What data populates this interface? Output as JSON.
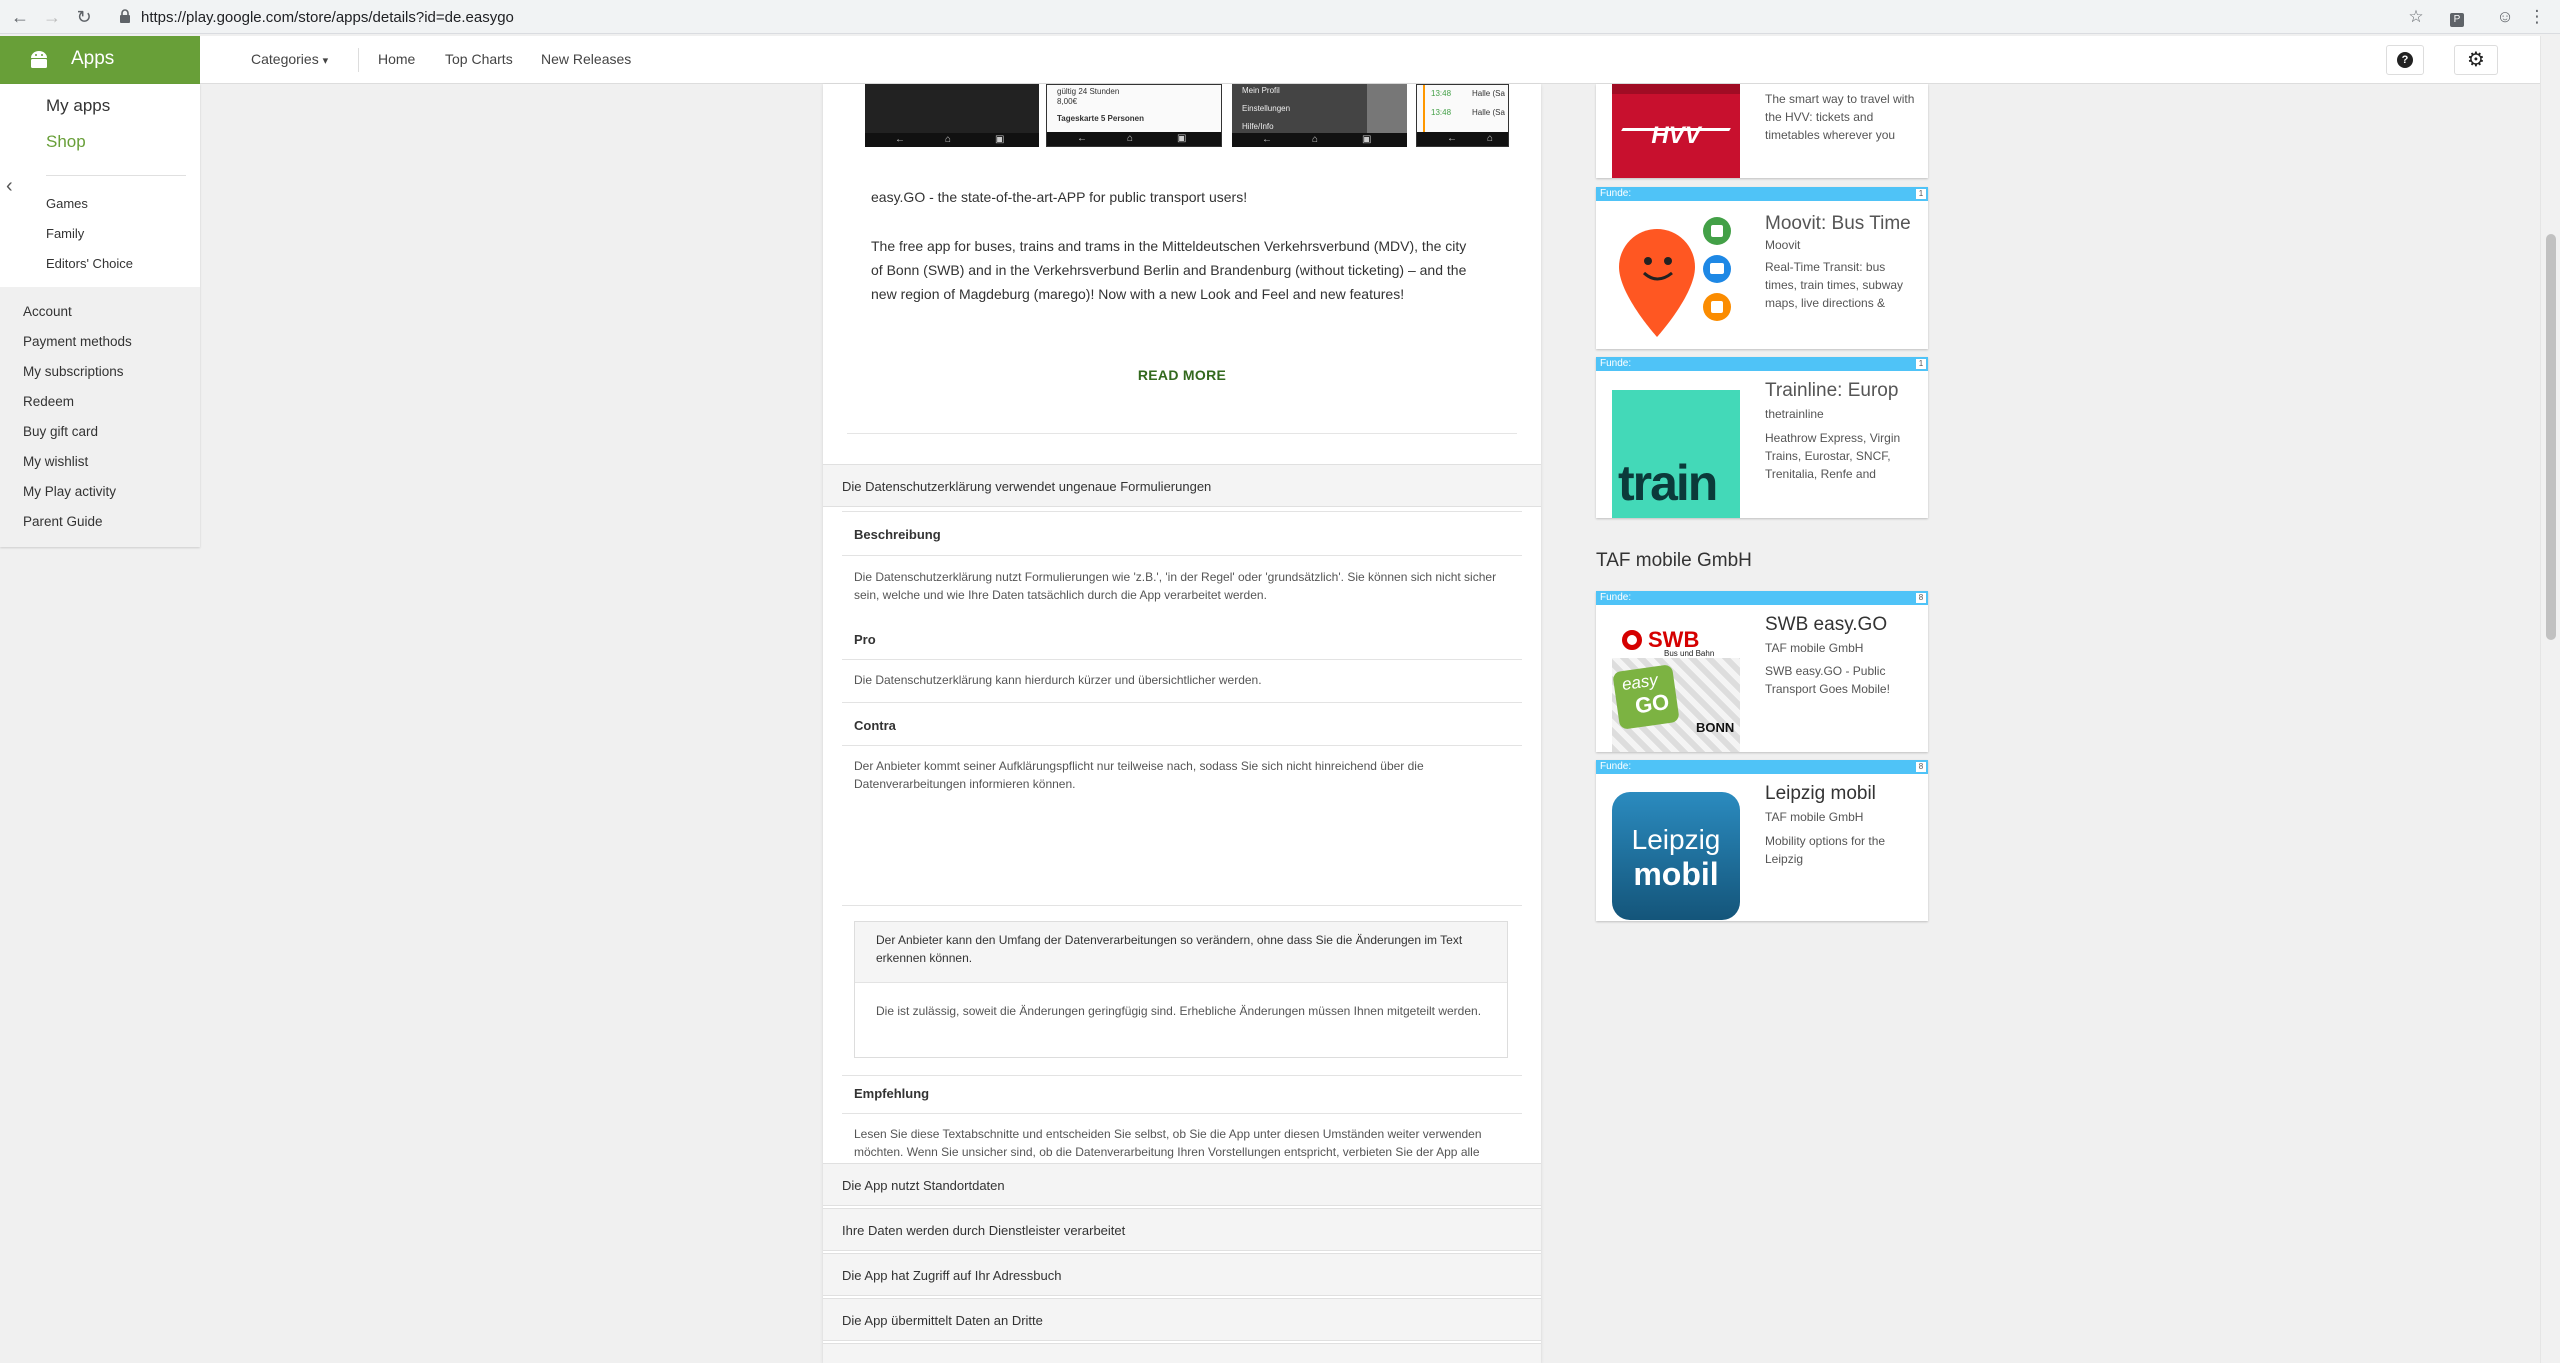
{
  "browser": {
    "url": "https://play.google.com/store/apps/details?id=de.easygo",
    "profile_letter": "P"
  },
  "header": {
    "apps_label": "Apps",
    "categories_label": "Categories",
    "home_label": "Home",
    "top_charts_label": "Top Charts",
    "new_releases_label": "New Releases",
    "help_glyph": "?"
  },
  "sidebar": {
    "my_apps": "My apps",
    "shop": "Shop",
    "items": [
      "Games",
      "Family",
      "Editors' Choice"
    ],
    "account_links": [
      "Account",
      "Payment methods",
      "My subscriptions",
      "Redeem",
      "Buy gift card",
      "My wishlist",
      "My Play activity",
      "Parent Guide"
    ]
  },
  "screenshots": {
    "shot2_line1": "gültig 24 Stunden",
    "shot2_line2": "8,00€",
    "shot2_line3": "Tageskarte 5 Personen",
    "shot3_line1": "Mein Profil",
    "shot3_line2": "Einstellungen",
    "shot3_line3": "Hilfe/Info",
    "shot4_line1": "13:48",
    "shot4_line2": "13:48",
    "shot4_label1": "Halle (Sa",
    "shot4_label2": "Halle (Sa"
  },
  "description": {
    "short": "easy.GO - the state-of-the-art-APP for public transport users!",
    "long": "The free app for buses, trains and trams in the Mitteldeutschen Verkehrsverbund (MDV), the city of Bonn (SWB) and in the Verkehrsverbund Berlin and Brandenburg (without ticketing) – and the new region of Magdeburg (marego)! Now with a new Look and Feel and new features!",
    "read_more": "READ MORE"
  },
  "privacy": {
    "open_title": "Die Datenschutzerklärung verwendet ungenaue Formulierungen",
    "beschreibung_title": "Beschreibung",
    "beschreibung_text": "Die Datenschutzerklärung nutzt Formulierungen wie 'z.B.', 'in der Regel' oder 'grundsätzlich'. Sie können sich nicht sicher sein, welche und wie Ihre Daten tatsächlich durch die App verarbeitet werden.",
    "pro_title": "Pro",
    "pro_text": "Die Datenschutzerklärung kann hierdurch kürzer und übersichtlicher werden.",
    "contra_title": "Contra",
    "contra_text": "Der Anbieter kommt seiner Aufklärungspflicht nur teilweise nach, sodass Sie sich nicht hinreichend über die Datenverarbeitungen informieren können.",
    "nested_title": "Der Anbieter kann den Umfang der Datenverarbeitungen so verändern, ohne dass Sie die Änderungen im Text erkennen können.",
    "nested_text": "Die ist zulässig, soweit die Änderungen geringfügig sind. Erhebliche Änderungen müssen Ihnen mitgeteilt werden.",
    "empfehlung_title": "Empfehlung",
    "empfehlung_text": "Lesen Sie diese Textabschnitte und entscheiden Sie selbst, ob Sie die App unter diesen Umständen weiter verwenden möchten. Wenn Sie unsicher sind, ob die Datenverarbeitung Ihren Vorstellungen entspricht, verbieten Sie der App alle Zugriffe auf Daten, die aus Ihrer Sicht besonders schützenswert sind (z.B. Fotos, Adressbuch, Standort oder Kalender).",
    "collapsed": [
      "Die App nutzt Standortdaten",
      "Ihre Daten werden durch Dienstleister verarbeitet",
      "Die App hat Zugriff auf Ihr Adressbuch",
      "Die App übermittelt Daten an Dritte"
    ]
  },
  "similar": {
    "hvv": {
      "desc": "The smart way to travel with the HVV: tickets and timetables wherever you",
      "logo_text": "HVV"
    },
    "moovit": {
      "funde": "Funde:",
      "count": "1",
      "title": "Moovit: Bus Time",
      "developer": "Moovit",
      "desc": "Real-Time Transit: bus times, train times, subway maps, live directions &"
    },
    "trainline": {
      "funde": "Funde:",
      "count": "1",
      "title": "Trainline:  Europ",
      "developer": "thetrainline",
      "desc": "Heathrow Express, Virgin Trains, Eurostar, SNCF, Trenitalia, Renfe and",
      "logo_text": "train"
    }
  },
  "developer_section": {
    "heading": "TAF mobile GmbH",
    "swb": {
      "funde": "Funde:",
      "count": "8",
      "title": "SWB easy.GO",
      "developer": "TAF mobile GmbH",
      "desc": "SWB easy.GO - Public Transport Goes Mobile!",
      "logo_brand": "SWB",
      "logo_sub": "Bus und Bahn",
      "logo_easy": "easy",
      "logo_go": "GO",
      "logo_city": "BONN"
    },
    "leipzig": {
      "funde": "Funde:",
      "count": "8",
      "title": "Leipzig mobil",
      "developer": "TAF mobile GmbH",
      "desc": "Mobility options for the Leipzig",
      "logo_line1": "Leipzig",
      "logo_line2": "mobil"
    }
  },
  "colors": {
    "play_green": "#689f38",
    "read_more_green": "#33691e",
    "funde_blue": "#4fc3f7",
    "hvv_red": "#c8102e",
    "moovit_orange": "#ff5722",
    "trainline_teal": "#43d9b8",
    "leipzig_blue": "#1a6c99"
  }
}
